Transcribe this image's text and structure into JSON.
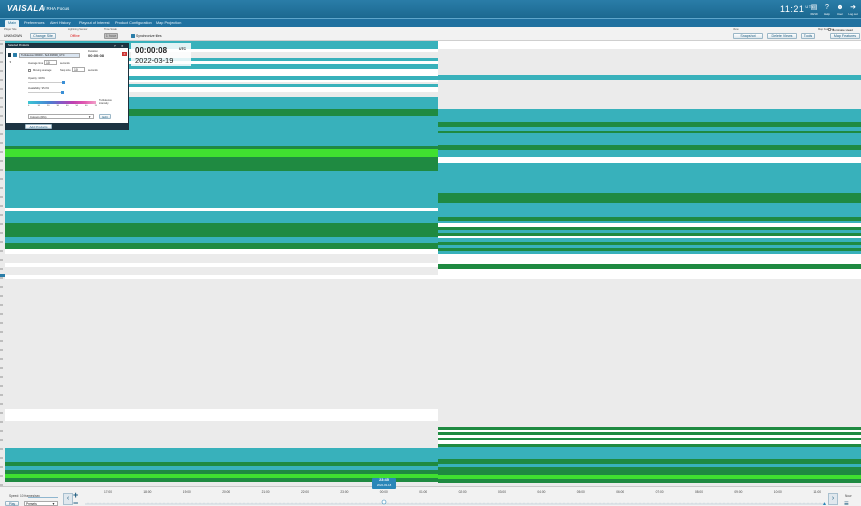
{
  "app": {
    "brand": "VAISALA",
    "title": "/ RHA Focus"
  },
  "clock": {
    "time": "11:21",
    "zone": "UTC"
  },
  "top_icons": [
    {
      "icon": "calendar-icon",
      "label": "09/19"
    },
    {
      "icon": "help-icon",
      "label": "Help"
    },
    {
      "icon": "user-icon",
      "label": "User"
    },
    {
      "icon": "logout-icon",
      "label": "Log out"
    }
  ],
  "menu": [
    "Main",
    "Preferences",
    "Alert History",
    "Playout of Interest",
    "Product Configuration",
    "Map Projection"
  ],
  "toolstrip": {
    "player_site_label": "Player Site",
    "player_site_value": "UNKNOWN",
    "change_site": "Change Site",
    "lightning_label": "Lightning Sensor",
    "lightning_value": "Offline",
    "time_scale_label": "Time Scale",
    "time_scale_value": "1 hour",
    "synchronize": "Synchronize tiles",
    "view_label": "View",
    "snapshot": "Snapshot",
    "delete_views": "Delete Views",
    "tools": "Tools",
    "map_features_label": "Map Features",
    "illuminate": "Illuminate Head",
    "map_features": "Map Features"
  },
  "panel": {
    "header": "Selected Products",
    "product": "Turbulence FR000 - Sub FR000_UTC",
    "duration_label": "Duration",
    "duration_value": "00:00:08",
    "average_label": "Average time",
    "average_value": "10",
    "average_unit": "seconds",
    "moving_average": "Moving average",
    "step_label": "Step size",
    "step_value": "10",
    "step_unit": "seconds",
    "opacity": "Opacity: 100%",
    "availability": "Availability: 95.0%",
    "colorbar_ticks": [
      "0",
      "10",
      "20",
      "30",
      "40",
      "50",
      "60",
      "70"
    ],
    "colorbar_unit": "Turbulence\nintensity",
    "colors_select": "Colours (RG)",
    "edit": "Edit",
    "add_products": "Add Products"
  },
  "datetime": {
    "time": "00:00:08",
    "zone": "UTC",
    "date": "2022-03-19"
  },
  "timeline": {
    "speed": "Speed: 10 frames/sec",
    "play": "Play",
    "mode": "Presets",
    "marker_time": "23:45",
    "marker_date": "2022-03-18",
    "ticks": [
      "17:00",
      "18:00",
      "19:00",
      "20:00",
      "21:00",
      "22:00",
      "23:00",
      "00:00",
      "01:00",
      "02:00",
      "03:00",
      "04:00",
      "05:00",
      "06:00",
      "07:00",
      "08:00",
      "09:00",
      "10:00",
      "11:00"
    ],
    "now": "Now"
  },
  "colors": {
    "teal": "#38b1bb",
    "dark_green": "#1f8a41",
    "bright_green": "#40e030",
    "white": "#ffffff",
    "grey": "#ebebeb",
    "brand_blue": "#1b6890"
  }
}
